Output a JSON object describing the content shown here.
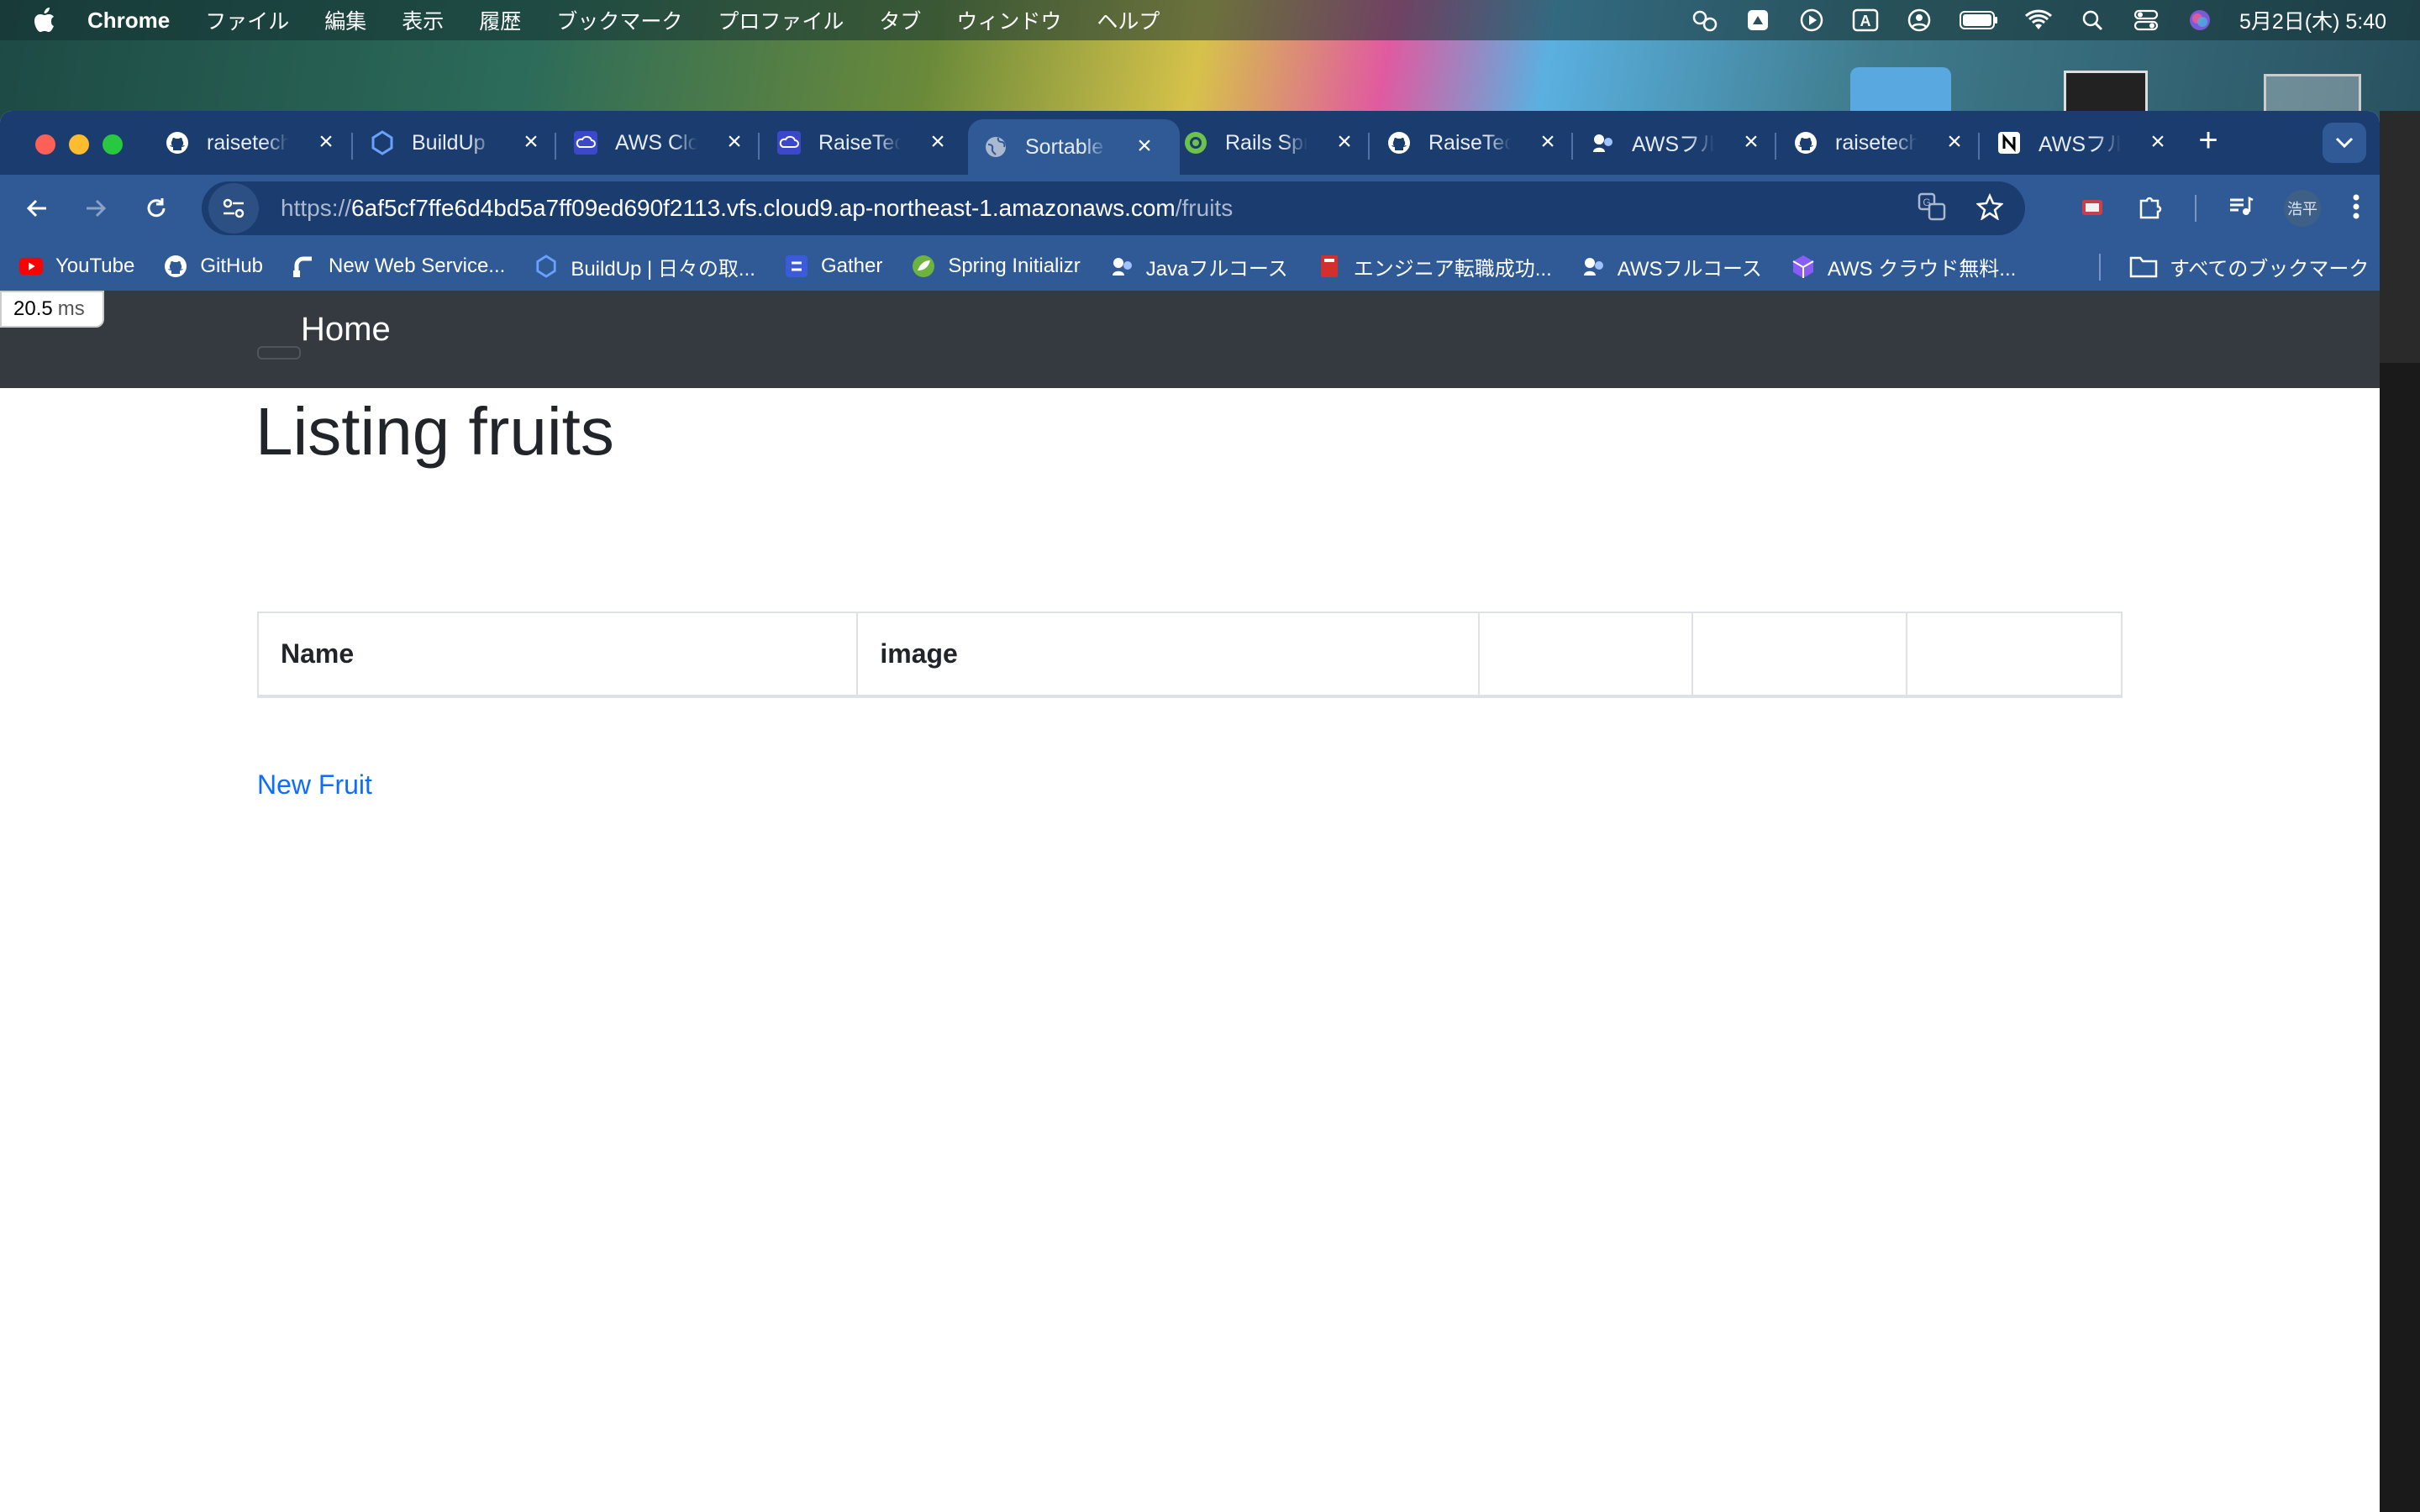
{
  "menubar": {
    "app_name": "Chrome",
    "menus": [
      "ファイル",
      "編集",
      "表示",
      "履歴",
      "ブックマーク",
      "プロファイル",
      "タブ",
      "ウィンドウ",
      "ヘルプ"
    ],
    "datetime": "5月2日(木) 5:40"
  },
  "tabs": [
    {
      "label": "raisetech",
      "icon": "github-icon"
    },
    {
      "label": "BuildUp",
      "icon": "buildup-icon"
    },
    {
      "label": "AWS Clo",
      "icon": "aws-cloud9-icon"
    },
    {
      "label": "RaiseTec",
      "icon": "aws-cloud9-icon"
    },
    {
      "label": "Sortable",
      "icon": "globe-icon",
      "active": true
    },
    {
      "label": "Rails Spr",
      "icon": "rails-icon"
    },
    {
      "label": "RaiseTec",
      "icon": "github-icon"
    },
    {
      "label": "AWSフル",
      "icon": "aws-course-icon"
    },
    {
      "label": "raisetech",
      "icon": "github-icon"
    },
    {
      "label": "AWSフル",
      "icon": "notion-icon"
    }
  ],
  "address_bar": {
    "scheme": "https://",
    "host": "6af5cf7ffe6d4bd5a7ff09ed690f2113.vfs.cloud9.ap-northeast-1.amazonaws.com",
    "path": "/fruits"
  },
  "profile_label": "浩平",
  "bookmarks": [
    {
      "label": "YouTube",
      "icon": "youtube-icon"
    },
    {
      "label": "GitHub",
      "icon": "github-icon"
    },
    {
      "label": "New Web Service...",
      "icon": "render-icon"
    },
    {
      "label": "BuildUp | 日々の取...",
      "icon": "buildup-icon"
    },
    {
      "label": "Gather",
      "icon": "gather-icon"
    },
    {
      "label": "Spring Initializr",
      "icon": "spring-icon"
    },
    {
      "label": "Javaフルコース",
      "icon": "java-course-icon"
    },
    {
      "label": "エンジニア転職成功...",
      "icon": "book-icon"
    },
    {
      "label": "AWSフルコース",
      "icon": "aws-course-icon"
    },
    {
      "label": "AWS クラウド無料...",
      "icon": "cube-icon"
    }
  ],
  "all_bookmarks_label": "すべてのブックマーク",
  "perf_badge": {
    "value": "20.5",
    "unit": "ms"
  },
  "page": {
    "navbar_brand": "Home",
    "title": "Listing fruits",
    "table_headers": [
      "Name",
      "image",
      "",
      "",
      ""
    ],
    "new_link": "New Fruit"
  },
  "colors": {
    "tabstrip": "#1b3c6e",
    "toolbar": "#2f5a96",
    "navbar": "#343a40",
    "link": "#0d6efd"
  }
}
